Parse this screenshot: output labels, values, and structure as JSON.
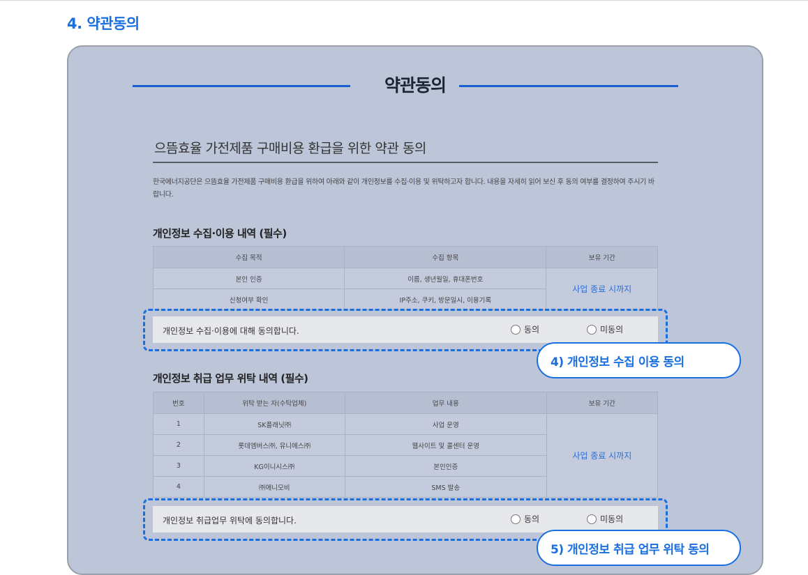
{
  "section_title": "4. 약관동의",
  "panel": {
    "header_title": "약관동의",
    "doc_title": "으뜸효율 가전제품 구매비용 환급을 위한 약관 동의",
    "intro": "한국에너지공단은 으뜸효율 가전제품 구매비용 환급을 위하여 아래와 같이 개인정보를 수집·이용 및 위탁하고자 합니다. 내용을 자세히 읽어 보신 후 동의 여부를 결정하여 주시기 바랍니다.",
    "collection": {
      "title": "개인정보 수집·이용 내역 (필수)",
      "headers": [
        "수집 목적",
        "수집 항목",
        "보유 기간"
      ],
      "rows": [
        [
          "본인 인증",
          "이름, 생년월일, 휴대폰번호"
        ],
        [
          "신청여부 확인",
          "IP주소, 쿠키, 방문일시, 이용기록"
        ]
      ],
      "retention": "사업 종료 시까지",
      "agree_text": "개인정보 수집·이용에 대해 동의합니다.",
      "agree_label": "동의",
      "disagree_label": "미동의",
      "callout": "4) 개인정보 수집 이용 동의"
    },
    "consignment": {
      "title": "개인정보 취급 업무 위탁 내역 (필수)",
      "headers": [
        "번호",
        "위탁 받는 자(수탁업체)",
        "업무 내용",
        "보유 기간"
      ],
      "rows": [
        [
          "1",
          "SK플래닛㈜",
          "사업 운영"
        ],
        [
          "2",
          "롯데엠버스㈜, 유니에스㈜",
          "웹사이트 및 콜센터 운영"
        ],
        [
          "3",
          "KG이니시스㈜",
          "본인인증"
        ],
        [
          "4",
          "㈜애니모비",
          "SMS 발송"
        ]
      ],
      "retention": "사업 종료 시까지",
      "agree_text": "개인정보 취급업무 위탁에 동의합니다.",
      "agree_label": "동의",
      "disagree_label": "미동의",
      "callout": "5) 개인정보 취급 업무 위탁 동의"
    }
  }
}
